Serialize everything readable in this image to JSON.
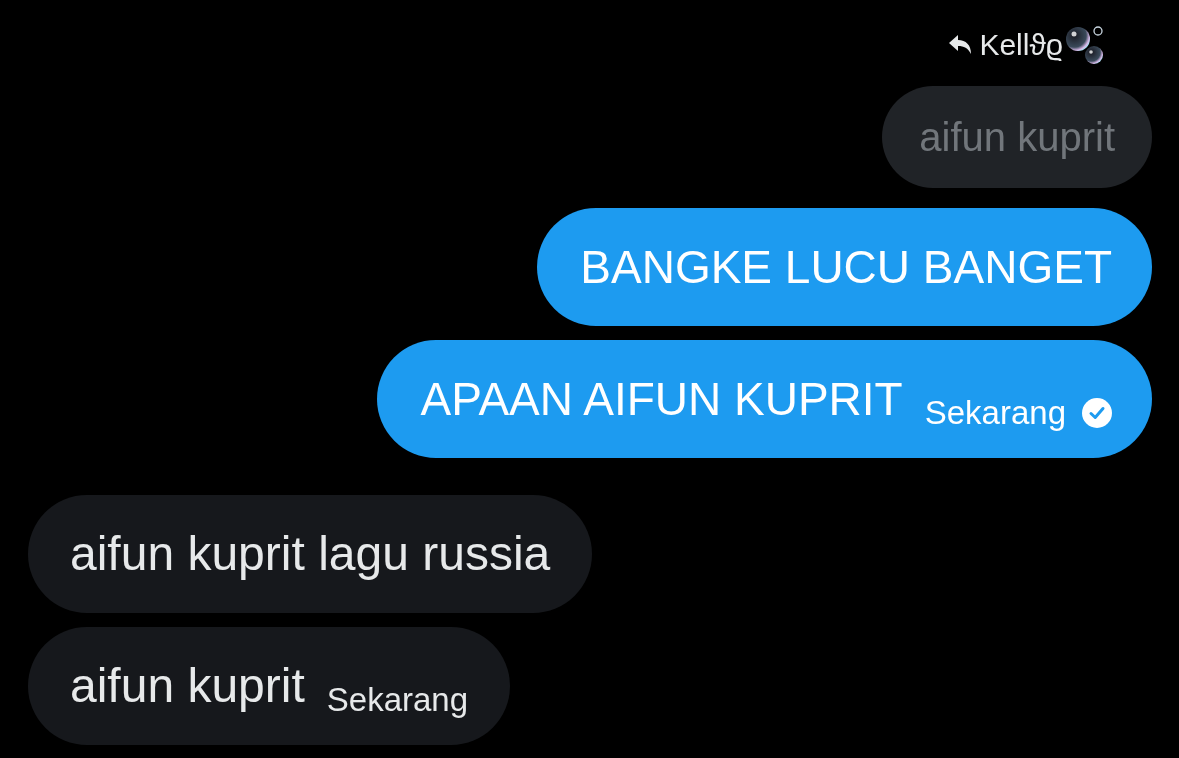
{
  "reply_header": {
    "name": "Kellϑϱ"
  },
  "messages": [
    {
      "kind": "quoted",
      "text": "aifun kuprit"
    },
    {
      "kind": "sent",
      "text": "BANGKE LUCU BANGET"
    },
    {
      "kind": "sent",
      "text": "APAAN AIFUN KUPRIT",
      "time": "Sekarang",
      "seen": true
    },
    {
      "kind": "received",
      "text": "aifun kuprit lagu russia"
    },
    {
      "kind": "received",
      "text": "aifun kuprit",
      "time": "Sekarang"
    }
  ]
}
